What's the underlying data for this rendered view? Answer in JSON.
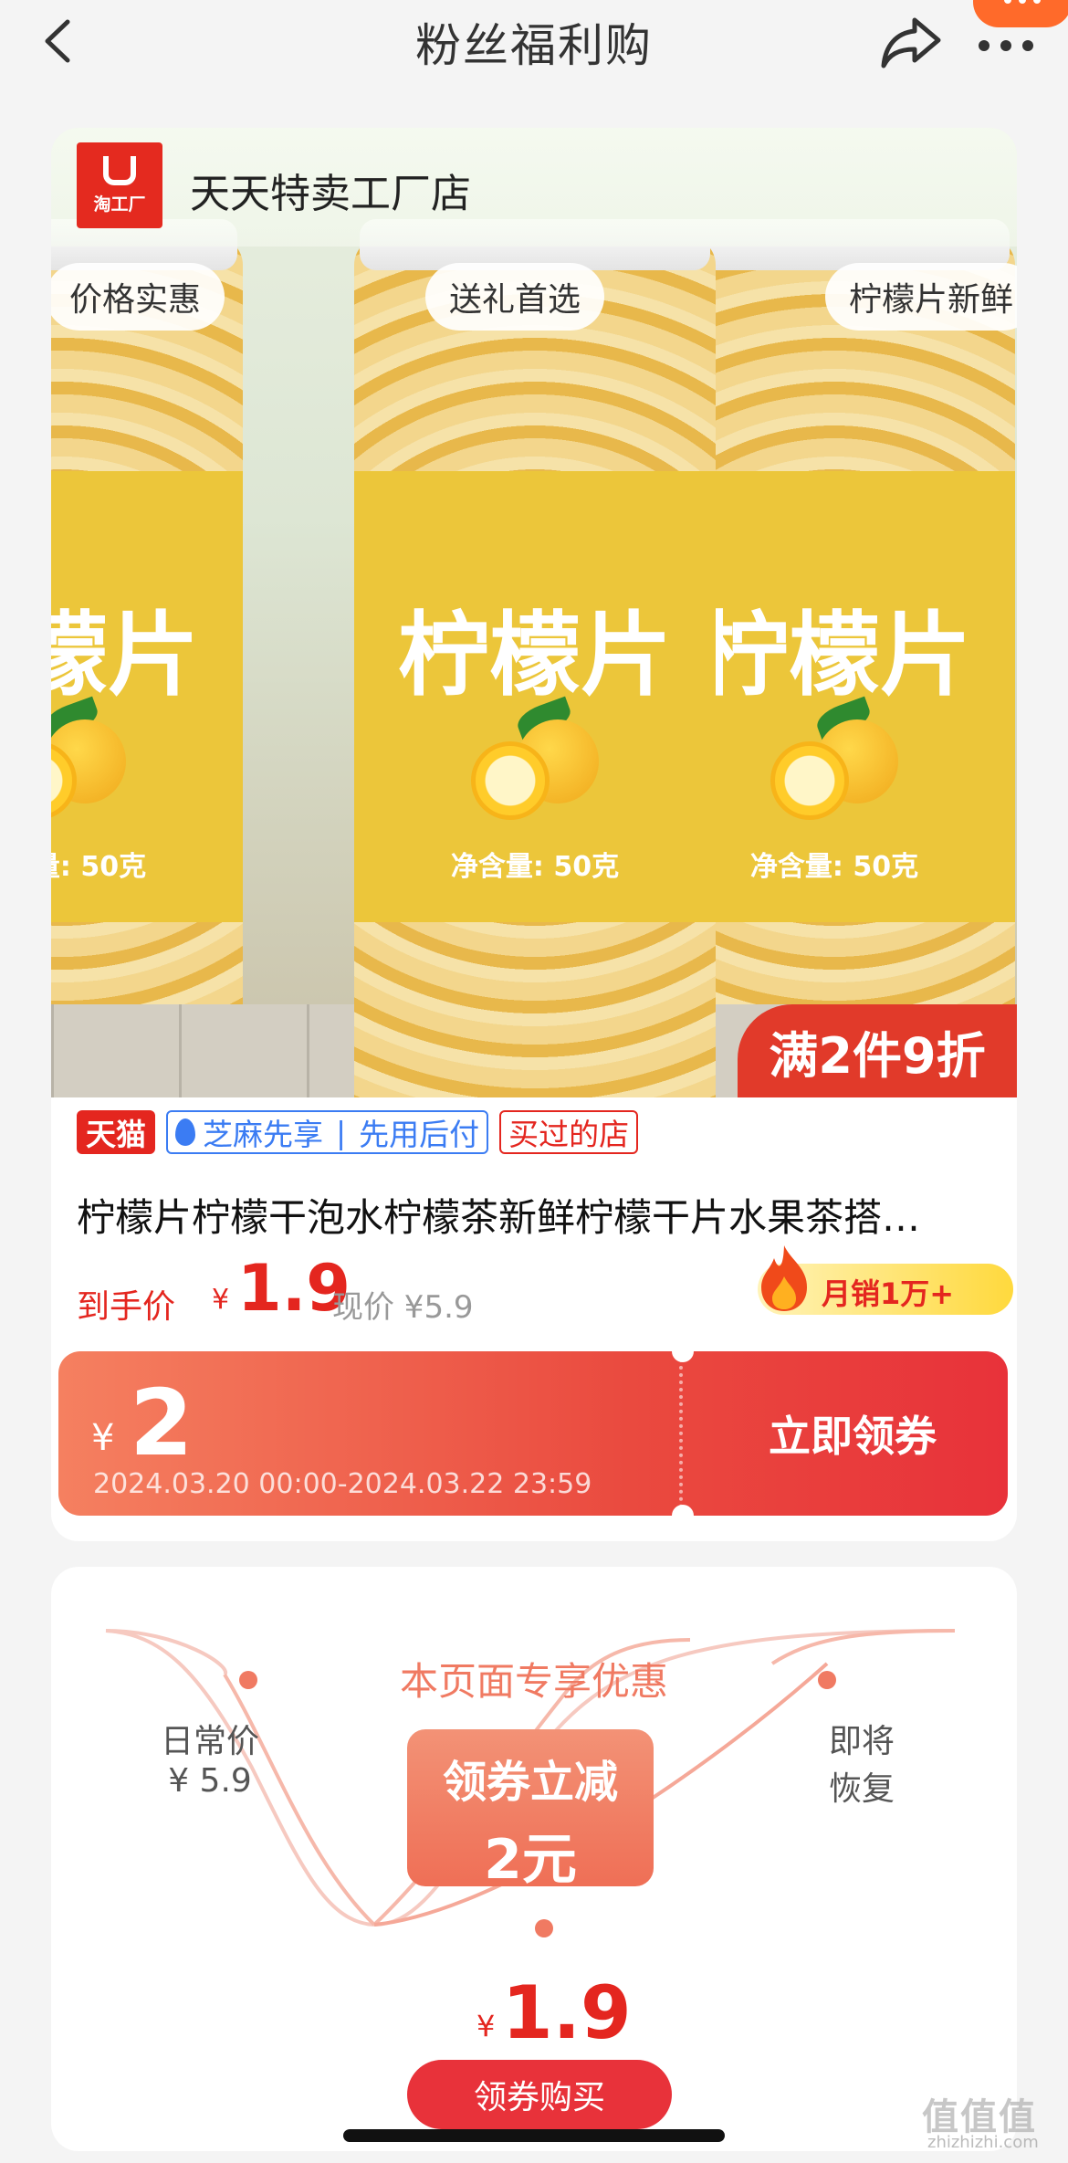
{
  "header": {
    "title": "粉丝福利购",
    "back_icon": "chevron-left-icon",
    "share_icon": "share-icon",
    "more_icon": "more-dots-icon"
  },
  "store": {
    "logo_text": "淘工厂",
    "name": "天天特卖工厂店"
  },
  "hero": {
    "tags": [
      "价格实惠",
      "送礼首选",
      "柠檬片新鲜"
    ],
    "jar_title": "柠檬片",
    "net_weight": "净含量: 50克",
    "promo_badge": "满2件9折"
  },
  "product": {
    "badges": {
      "tmall": "天猫",
      "zhima_1": "芝麻先享",
      "zhima_sep": "|",
      "zhima_2": "先用后付",
      "bought": "买过的店"
    },
    "title": "柠檬片柠檬干泡水柠檬茶新鲜柠檬干片水果茶搭…",
    "price_label": "到手价",
    "currency": "¥",
    "price": "1.9",
    "original_price": "现价 ¥5.9",
    "sales": "月销1万+"
  },
  "coupon": {
    "currency": "¥",
    "amount": "2",
    "validity": "2024.03.20 00:00-2024.03.22 23:59",
    "button": "立即领券"
  },
  "benefit": {
    "title": "本页面专享优惠",
    "daily_label": "日常价",
    "daily_price": "¥ 5.9",
    "resume_line1": "即将",
    "resume_line2": "恢复",
    "discount_line1": "领券立减",
    "discount_line2": "2元",
    "final_currency": "¥",
    "final_price": "1.9",
    "buy_button": "领券购买"
  },
  "watermark": {
    "main": "值值值",
    "sub": "zhizhizhi.com"
  },
  "colors": {
    "accent_red": "#e4261f",
    "coupon_orange": "#f58060",
    "page_bg": "#f4f4f4"
  }
}
